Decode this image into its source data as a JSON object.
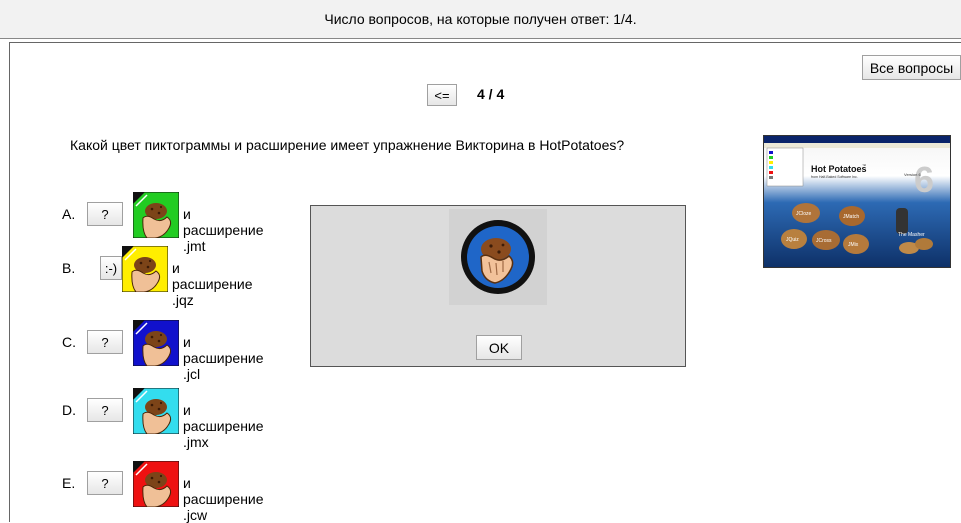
{
  "status": {
    "text": "Число вопросов, на которые получен ответ: 1/4."
  },
  "nav": {
    "all_questions_label": "Все вопросы",
    "prev_label": "<=",
    "counter": "4 / 4"
  },
  "question": {
    "text": "Какой цвет пиктограммы и расширение имеет упражнение Викторина в HotPotatoes?"
  },
  "answers": [
    {
      "letter": "A.",
      "button": "?",
      "icon_color": "#22cc22",
      "text": "и расширение .jmt"
    },
    {
      "letter": "B.",
      "button": ":-)",
      "icon_color": "#ffee00",
      "text": "и расширение .jqz"
    },
    {
      "letter": "C.",
      "button": "?",
      "icon_color": "#1111cc",
      "text": "и расширение .jcl"
    },
    {
      "letter": "D.",
      "button": "?",
      "icon_color": "#33ddee",
      "text": "и расширение .jmx"
    },
    {
      "letter": "E.",
      "button": "?",
      "icon_color": "#ee1111",
      "text": "и расширение .jcw"
    }
  ],
  "dialog": {
    "ok_label": "OK"
  },
  "screenshot": {
    "title": "Hot Potatoes",
    "tm": "™",
    "subtitle": "from Half-Baked Software Inc.",
    "version": "Version 6",
    "big_number": "6",
    "potatoes": [
      "JCloze",
      "JMatch",
      "JQuiz",
      "JCross",
      "JMix",
      "The Masher"
    ]
  }
}
